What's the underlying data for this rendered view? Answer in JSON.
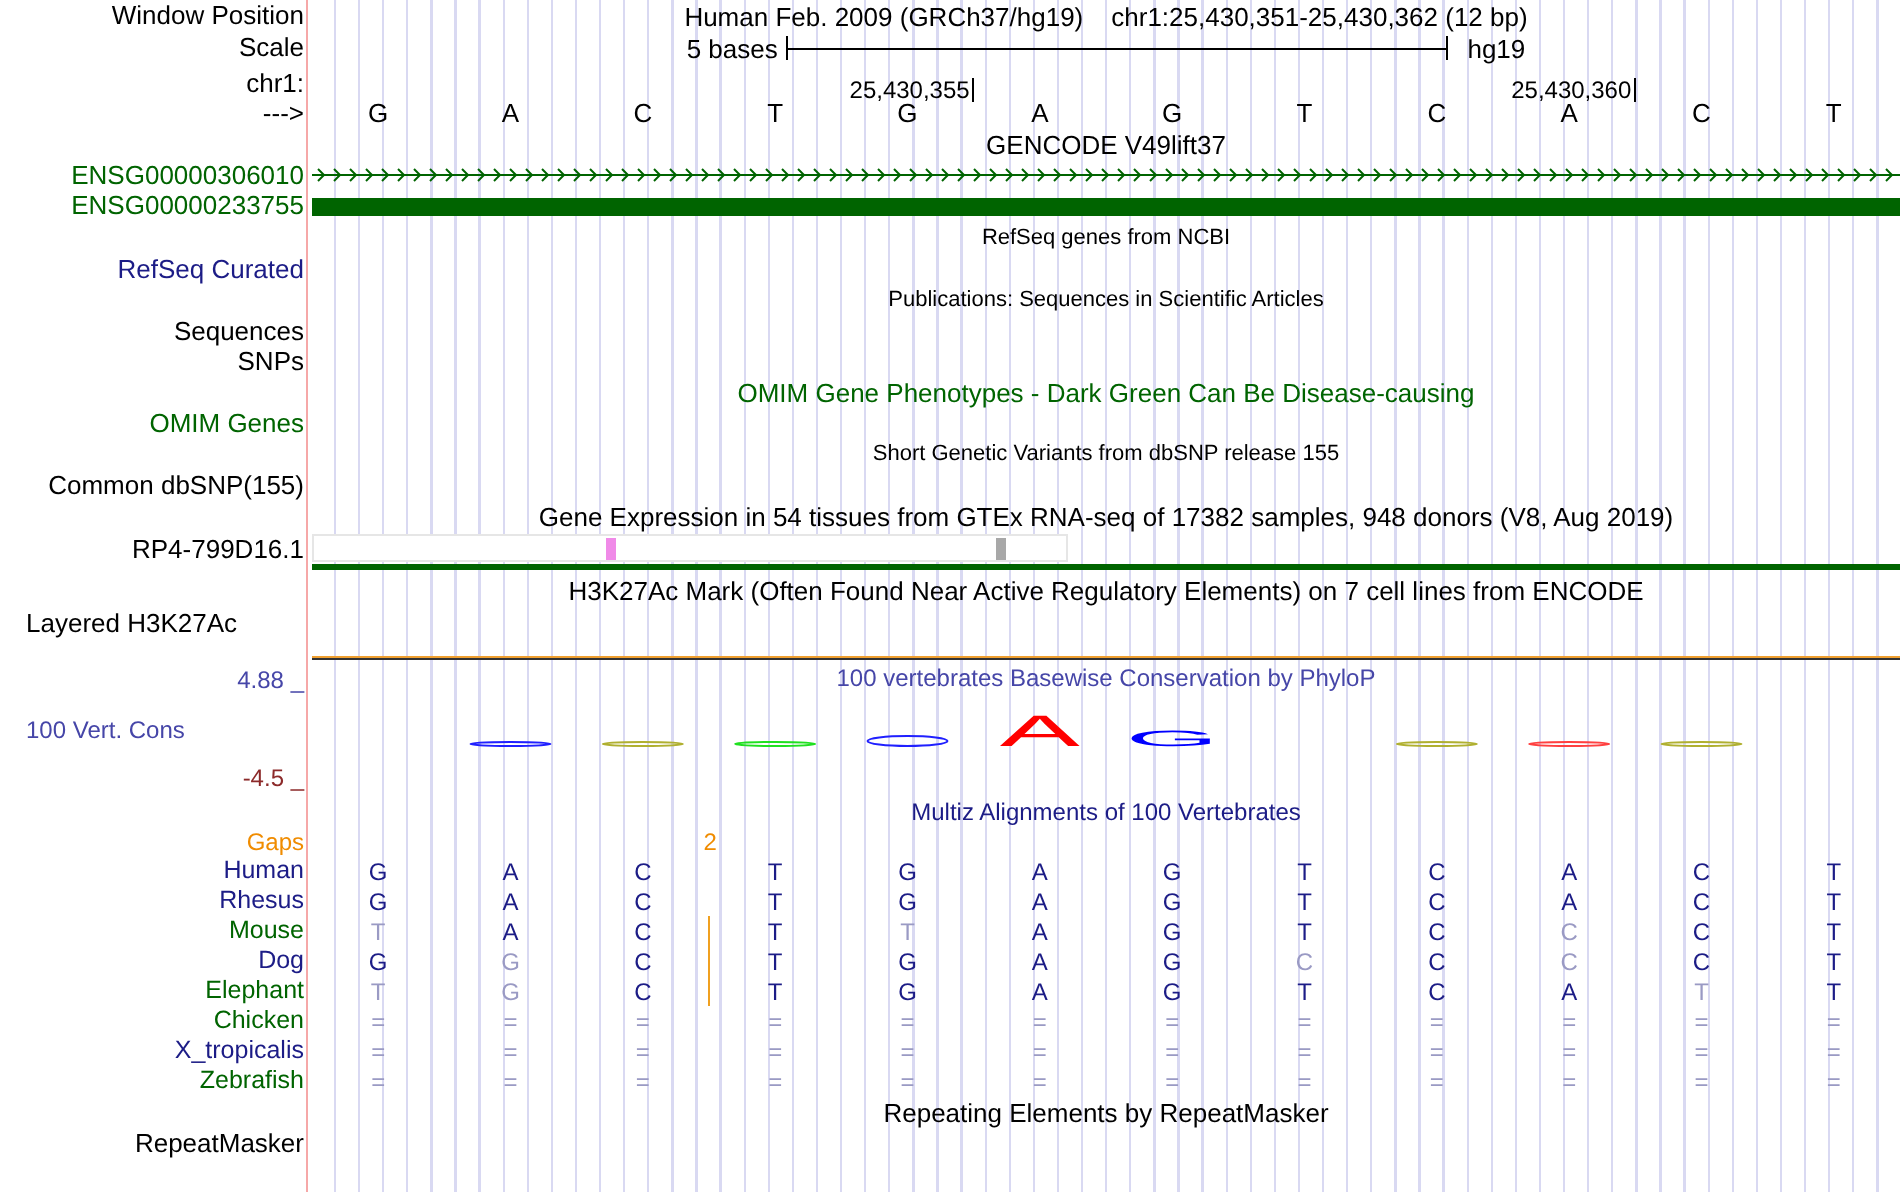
{
  "position": {
    "label": "Window Position",
    "assembly": "Human Feb. 2009 (GRCh37/hg19)",
    "range": "chr1:25,430,351-25,430,362 (12 bp)"
  },
  "scale": {
    "label": "Scale",
    "span": "5 bases",
    "assembly": "hg19"
  },
  "ruler": {
    "label": "chr1:",
    "ticks": [
      "25,430,355",
      "25,430,360"
    ]
  },
  "sequence": {
    "label": "--->",
    "bases": [
      "G",
      "A",
      "C",
      "T",
      "G",
      "A",
      "G",
      "T",
      "C",
      "A",
      "C",
      "T"
    ]
  },
  "gencode": {
    "title": "GENCODE V49lift37",
    "genes": [
      {
        "label": "ENSG00000306010",
        "kind": "arrows",
        "color": "#006400"
      },
      {
        "label": "ENSG00000233755",
        "kind": "block",
        "color": "#006400"
      }
    ]
  },
  "tracks": [
    {
      "kind": "compact",
      "title": "RefSeq genes from NCBI",
      "color": "#000000",
      "labels": [
        {
          "text": "RefSeq Curated",
          "color": "#1c1c86"
        }
      ]
    },
    {
      "kind": "compact",
      "title": "Publications: Sequences in Scientific Articles",
      "color": "#000000",
      "labels": [
        {
          "text": "Sequences",
          "color": "#000000"
        },
        {
          "text": "SNPs",
          "color": "#000000"
        }
      ]
    },
    {
      "kind": "full",
      "title": "OMIM Gene Phenotypes - Dark Green Can Be Disease-causing",
      "color": "#006400",
      "labels": [
        {
          "text": "OMIM Genes",
          "color": "#006400"
        }
      ]
    },
    {
      "kind": "compact",
      "title": "Short Genetic Variants from dbSNP release 155",
      "color": "#000000",
      "labels": [
        {
          "text": "Common dbSNP(155)",
          "color": "#000000"
        }
      ]
    },
    {
      "kind": "expression",
      "title": "Gene Expression in 54 tissues from GTEx RNA-seq of 17382 samples, 948 donors (V8, Aug 2019)",
      "color": "#000000",
      "labels": [
        {
          "text": "RP4-799D16.1",
          "color": "#000000"
        }
      ]
    },
    {
      "kind": "layered",
      "title": "H3K27Ac Mark (Often Found Near Active Regulatory Elements) on 7 cell lines from ENCODE",
      "color": "#000000",
      "labels": [
        {
          "text": "Layered H3K27Ac",
          "color": "#000000"
        }
      ]
    }
  ],
  "conservation": {
    "title": "100 vertebrates Basewise Conservation by PhyloP",
    "label": "100 Vert. Cons",
    "max": "4.88 _",
    "min": "-4.5 _",
    "letters": [
      {
        "text": "A",
        "color": "#ff0000"
      },
      {
        "text": "G",
        "color": "#0000ff"
      }
    ]
  },
  "multiz": {
    "title": "Multiz Alignments of 100 Vertebrates",
    "gaps": {
      "label": "Gaps",
      "count": "2"
    },
    "species": [
      {
        "name": "Human",
        "color": "#1c1c86",
        "bases": [
          {
            "text": "G",
            "dim": false
          },
          {
            "text": "A",
            "dim": false
          },
          {
            "text": "C",
            "dim": false
          },
          {
            "text": "T",
            "dim": false
          },
          {
            "text": "G",
            "dim": false
          },
          {
            "text": "A",
            "dim": false
          },
          {
            "text": "G",
            "dim": false
          },
          {
            "text": "T",
            "dim": false
          },
          {
            "text": "C",
            "dim": false
          },
          {
            "text": "A",
            "dim": false
          },
          {
            "text": "C",
            "dim": false
          },
          {
            "text": "T",
            "dim": false
          }
        ]
      },
      {
        "name": "Rhesus",
        "color": "#1c1c86",
        "bases": [
          {
            "text": "G",
            "dim": false
          },
          {
            "text": "A",
            "dim": false
          },
          {
            "text": "C",
            "dim": false
          },
          {
            "text": "T",
            "dim": false
          },
          {
            "text": "G",
            "dim": false
          },
          {
            "text": "A",
            "dim": false
          },
          {
            "text": "G",
            "dim": false
          },
          {
            "text": "T",
            "dim": false
          },
          {
            "text": "C",
            "dim": false
          },
          {
            "text": "A",
            "dim": false
          },
          {
            "text": "C",
            "dim": false
          },
          {
            "text": "T",
            "dim": false
          }
        ]
      },
      {
        "name": "Mouse",
        "color": "#006400",
        "bases": [
          {
            "text": "T",
            "dim": true
          },
          {
            "text": "A",
            "dim": false
          },
          {
            "text": "C",
            "dim": false,
            "insert_after": true
          },
          {
            "text": "T",
            "dim": false
          },
          {
            "text": "T",
            "dim": true
          },
          {
            "text": "A",
            "dim": false
          },
          {
            "text": "G",
            "dim": false
          },
          {
            "text": "T",
            "dim": false
          },
          {
            "text": "C",
            "dim": false
          },
          {
            "text": "C",
            "dim": true
          },
          {
            "text": "C",
            "dim": false
          },
          {
            "text": "T",
            "dim": false
          }
        ]
      },
      {
        "name": "Dog",
        "color": "#1c1c86",
        "bases": [
          {
            "text": "G",
            "dim": false
          },
          {
            "text": "G",
            "dim": true
          },
          {
            "text": "C",
            "dim": false,
            "insert_after": true
          },
          {
            "text": "T",
            "dim": false
          },
          {
            "text": "G",
            "dim": false
          },
          {
            "text": "A",
            "dim": false
          },
          {
            "text": "G",
            "dim": false
          },
          {
            "text": "C",
            "dim": true
          },
          {
            "text": "C",
            "dim": false
          },
          {
            "text": "C",
            "dim": true
          },
          {
            "text": "C",
            "dim": false
          },
          {
            "text": "T",
            "dim": false
          }
        ]
      },
      {
        "name": "Elephant",
        "color": "#006400",
        "bases": [
          {
            "text": "T",
            "dim": true
          },
          {
            "text": "G",
            "dim": true
          },
          {
            "text": "C",
            "dim": false,
            "insert_after": true
          },
          {
            "text": "T",
            "dim": false
          },
          {
            "text": "G",
            "dim": false
          },
          {
            "text": "A",
            "dim": false
          },
          {
            "text": "G",
            "dim": false
          },
          {
            "text": "T",
            "dim": false
          },
          {
            "text": "C",
            "dim": false
          },
          {
            "text": "A",
            "dim": false
          },
          {
            "text": "T",
            "dim": true
          },
          {
            "text": "T",
            "dim": false
          }
        ]
      },
      {
        "name": "Chicken",
        "color": "#006400",
        "bases": [
          {
            "text": "=",
            "dim": true
          },
          {
            "text": "=",
            "dim": true
          },
          {
            "text": "=",
            "dim": true
          },
          {
            "text": "=",
            "dim": true
          },
          {
            "text": "=",
            "dim": true
          },
          {
            "text": "=",
            "dim": true
          },
          {
            "text": "=",
            "dim": true
          },
          {
            "text": "=",
            "dim": true
          },
          {
            "text": "=",
            "dim": true
          },
          {
            "text": "=",
            "dim": true
          },
          {
            "text": "=",
            "dim": true
          },
          {
            "text": "=",
            "dim": true
          }
        ]
      },
      {
        "name": "X_tropicalis",
        "color": "#1c1c86",
        "bases": [
          {
            "text": "=",
            "dim": true
          },
          {
            "text": "=",
            "dim": true
          },
          {
            "text": "=",
            "dim": true
          },
          {
            "text": "=",
            "dim": true
          },
          {
            "text": "=",
            "dim": true
          },
          {
            "text": "=",
            "dim": true
          },
          {
            "text": "=",
            "dim": true
          },
          {
            "text": "=",
            "dim": true
          },
          {
            "text": "=",
            "dim": true
          },
          {
            "text": "=",
            "dim": true
          },
          {
            "text": "=",
            "dim": true
          },
          {
            "text": "=",
            "dim": true
          }
        ]
      },
      {
        "name": "Zebrafish",
        "color": "#006400",
        "bases": [
          {
            "text": "=",
            "dim": true
          },
          {
            "text": "=",
            "dim": true
          },
          {
            "text": "=",
            "dim": true
          },
          {
            "text": "=",
            "dim": true
          },
          {
            "text": "=",
            "dim": true
          },
          {
            "text": "=",
            "dim": true
          },
          {
            "text": "=",
            "dim": true
          },
          {
            "text": "=",
            "dim": true
          },
          {
            "text": "=",
            "dim": true
          },
          {
            "text": "=",
            "dim": true
          },
          {
            "text": "=",
            "dim": true
          },
          {
            "text": "=",
            "dim": true
          }
        ]
      }
    ]
  },
  "repeats": {
    "title": "Repeating Elements by RepeatMasker",
    "label": "RepeatMasker"
  }
}
